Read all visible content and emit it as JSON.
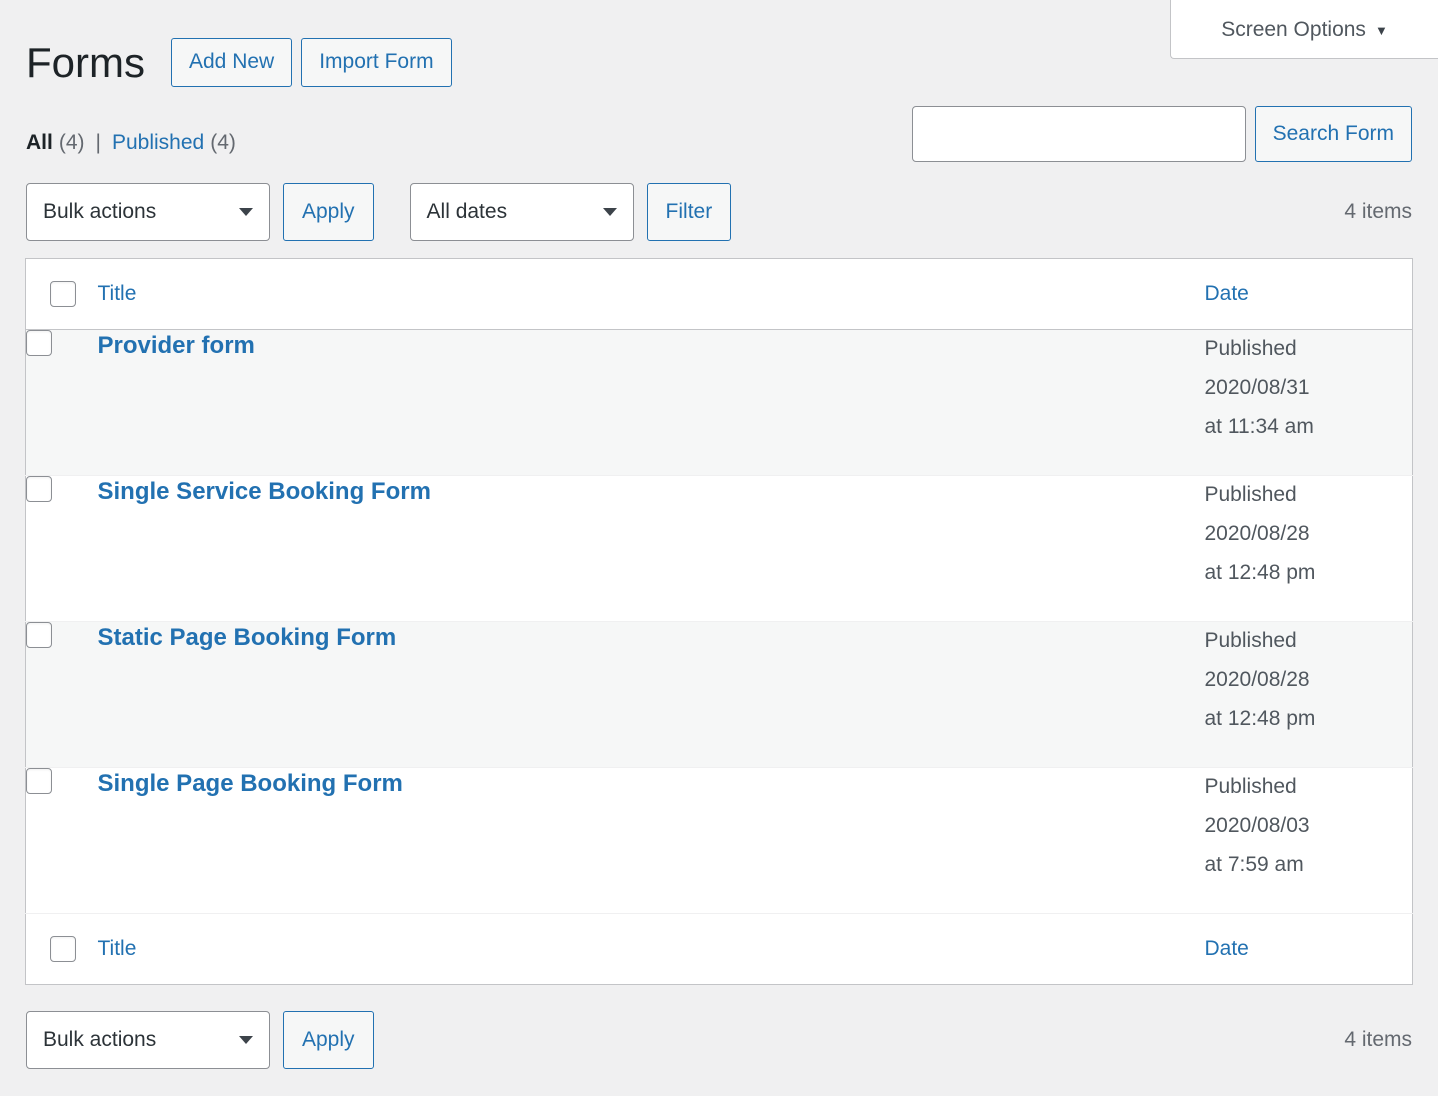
{
  "screen_meta": {
    "toggle_label": "Screen Options",
    "caret": "▼"
  },
  "header": {
    "title": "Forms",
    "actions": [
      {
        "label": "Add New"
      },
      {
        "label": "Import Form"
      }
    ]
  },
  "views": {
    "all_label": "All",
    "all_count": "(4)",
    "separator": "|",
    "published_label": "Published",
    "published_count": "(4)"
  },
  "search": {
    "value": "",
    "placeholder": "",
    "submit_label": "Search Form"
  },
  "tablenav_top": {
    "bulk_actions_label": "Bulk actions",
    "apply_label": "Apply",
    "dates_label": "All dates",
    "filter_label": "Filter",
    "displaying_num": "4 items"
  },
  "tablenav_bottom": {
    "bulk_actions_label": "Bulk actions",
    "apply_label": "Apply",
    "displaying_num": "4 items"
  },
  "table": {
    "columns": {
      "title": "Title",
      "date": "Date"
    },
    "rows": [
      {
        "title": "Provider form",
        "status": "Published",
        "date": "2020/08/31",
        "time": "at 11:34 am"
      },
      {
        "title": "Single Service Booking Form",
        "status": "Published",
        "date": "2020/08/28",
        "time": "at 12:48 pm"
      },
      {
        "title": "Static Page Booking Form",
        "status": "Published",
        "date": "2020/08/28",
        "time": "at 12:48 pm"
      },
      {
        "title": "Single Page Booking Form",
        "status": "Published",
        "date": "2020/08/03",
        "time": "at 7:59 am"
      }
    ]
  },
  "colors": {
    "page_background": "#f0f0f1",
    "link_blue": "#2271b1",
    "border_gray": "#c3c4c7",
    "alt_row": "#f6f7f7",
    "text_dark": "#1d2327",
    "text_muted": "#646970"
  }
}
